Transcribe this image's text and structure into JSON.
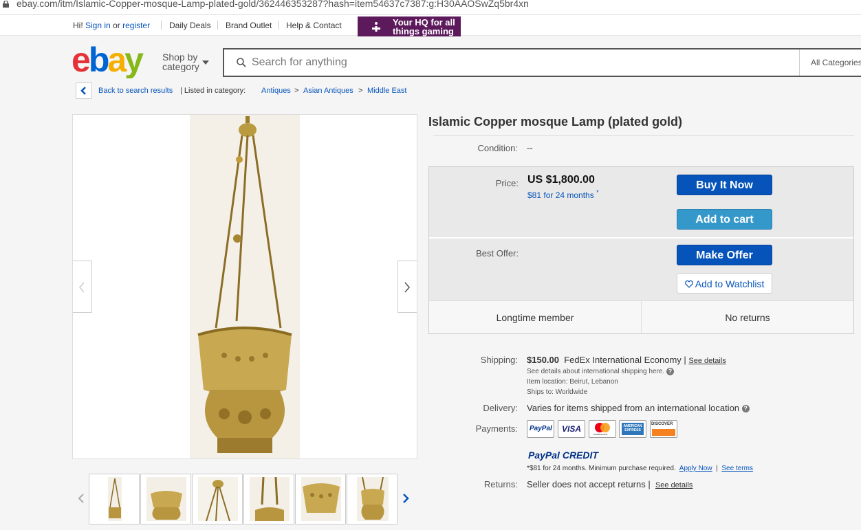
{
  "browser": {
    "url": "ebay.com/itm/Islamic-Copper-mosque-Lamp-plated-gold/362446353287?hash=item54637c7387:g:H30AAOSwZq5br4xn"
  },
  "global_header": {
    "greeting": "Hi!",
    "sign_in": "Sign in",
    "or": "or",
    "register": "register",
    "links": [
      "Daily Deals",
      "Brand Outlet",
      "Help & Contact"
    ],
    "promo": "Your HQ for all things gaming"
  },
  "header": {
    "shop_by": "Shop by",
    "category": "category",
    "search_placeholder": "Search for anything",
    "all_categories": "All Categories"
  },
  "breadcrumb": {
    "back": "Back to search results",
    "listed_in": "| Listed in category:",
    "categories": [
      "Antiques",
      "Asian Antiques",
      "Middle East"
    ],
    "sep": ">"
  },
  "item": {
    "title": "Islamic Copper mosque Lamp (plated gold)",
    "condition_label": "Condition:",
    "condition_value": "--",
    "price_label": "Price:",
    "price": "US $1,800.00",
    "monthly": "$81 for 24 months",
    "monthly_mark": "*",
    "buy_now": "Buy It Now",
    "add_to_cart": "Add to cart",
    "best_offer_label": "Best Offer:",
    "make_offer": "Make Offer",
    "watchlist": "Add to Watchlist",
    "features": [
      "Longtime member",
      "No returns"
    ]
  },
  "shipping": {
    "label": "Shipping:",
    "cost": "$150.00",
    "service": "FedEx International Economy |",
    "see_details": "See details",
    "intl_note": "See details about international shipping here.",
    "location": "Item location:  Beirut, Lebanon",
    "ships_to": "Ships to:  Worldwide"
  },
  "delivery": {
    "label": "Delivery:",
    "text": "Varies for items shipped from an international location"
  },
  "payments": {
    "label": "Payments:",
    "cards": [
      "PayPal",
      "VISA",
      "mastercard",
      "AMERICAN EXPRESS",
      "DISCOVER"
    ],
    "paypal_credit_a": "PayPal",
    "paypal_credit_b": "CREDIT",
    "credit_note": "*$81 for 24 months. Minimum purchase required.",
    "apply_now": "Apply Now",
    "pipe": "|",
    "see_terms": "See terms"
  },
  "returns": {
    "label": "Returns:",
    "text": "Seller does not accept returns |",
    "see_details": "See details"
  },
  "colors": {
    "ebay_blue": "#0654ba",
    "buy_blue": "#0654ba",
    "cart_blue": "#3498ca",
    "promo_purple": "#5c1a5c"
  }
}
